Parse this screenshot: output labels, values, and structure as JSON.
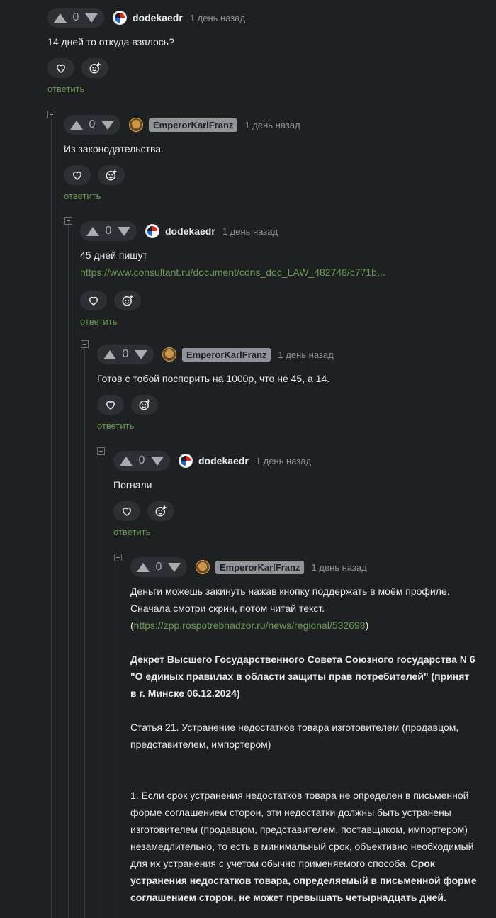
{
  "comments": [
    {
      "score": "0",
      "user": "dodekaedr",
      "time": "1 день назад",
      "text": "14 дней то откуда взялось?",
      "reply": "ответить"
    },
    {
      "score": "0",
      "user": "EmperorKarlFranz",
      "time": "1 день назад",
      "text": "Из законодательства.",
      "reply": "ответить"
    },
    {
      "score": "0",
      "user": "dodekaedr",
      "time": "1 день назад",
      "text": "45 дней пишут",
      "link": "https://www.consultant.ru/document/cons_doc_LAW_482748/c771b...",
      "reply": "ответить"
    },
    {
      "score": "0",
      "user": "EmperorKarlFranz",
      "time": "1 день назад",
      "text": "Готов с тобой поспорить на 1000р, что не 45, а 14.",
      "reply": "ответить"
    },
    {
      "score": "0",
      "user": "dodekaedr",
      "time": "1 день назад",
      "text": "Погнали",
      "reply": "ответить"
    },
    {
      "score": "0",
      "user": "EmperorKarlFranz",
      "time": "1 день назад",
      "line1": "Деньги можешь закинуть нажав кнопку поддержать в моём профиле.",
      "line2": "Сначала смотри скрин, потом читай текст.",
      "paren_open": "(",
      "link": "https://zpp.rospotrebnadzor.ru/news/regional/532698",
      "paren_close": ")",
      "decree": "Декрет Высшего Государственного Совета Союзного государства N 6 \"О единых правилах в области защиты прав потребителей\" (принят в г. Минске 06.12.2024)",
      "article": "Статья 21. Устранение недостатков товара изготовителем (продавцом, представителем, импортером)",
      "para1": "1. Если срок устранения недостатков товара не определен в письменной форме соглашением сторон, эти недостатки должны быть устранены изготовителем (продавцом, представителем, поставщиком, импортером) незамедлительно, то есть в минимальный срок, объективно необходимый для их устранения с учетом обычно применяемого способа. ",
      "para1_bold": "Срок устранения недостатков товара, определяемый в письменной форме соглашением сторон, не может превышать четырнадцать дней."
    }
  ],
  "colors": {
    "background": "#1e2022",
    "link": "#6a9a55",
    "button_bg": "#2c2f33"
  },
  "icons": {
    "upvote": "arrow-up-icon",
    "downvote": "arrow-down-icon",
    "like": "heart-icon",
    "react": "smiley-plus-icon",
    "collapse": "minus-box-icon"
  }
}
